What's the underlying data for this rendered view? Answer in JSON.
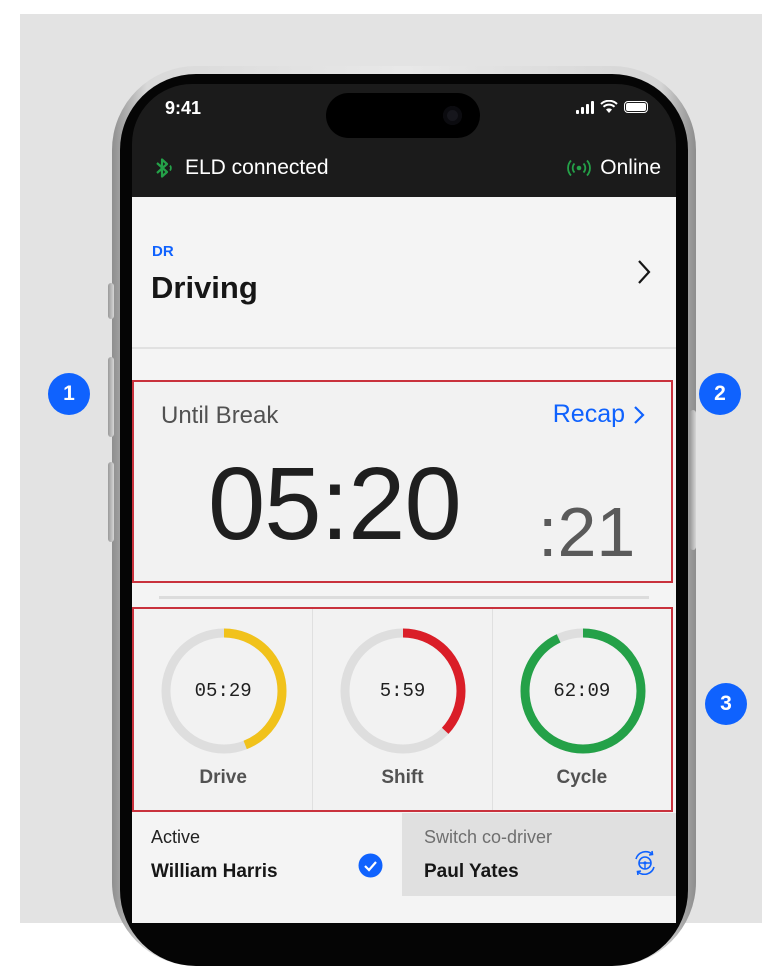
{
  "status_bar": {
    "time": "9:41"
  },
  "connection": {
    "eld_label": "ELD connected",
    "network_label": "Online"
  },
  "duty_status": {
    "code": "DR",
    "title": "Driving"
  },
  "break_timer": {
    "label": "Until Break",
    "recap_label": "Recap",
    "hours_minutes": "05:20",
    "seconds": ":21"
  },
  "gauges": [
    {
      "label": "Drive",
      "value": "05:29",
      "fraction": 0.44,
      "color": "#f1c21b"
    },
    {
      "label": "Shift",
      "value": "5:59",
      "fraction": 0.37,
      "color": "#da1e28"
    },
    {
      "label": "Cycle",
      "value": "62:09",
      "fraction": 0.93,
      "color": "#24a148"
    }
  ],
  "drivers": {
    "active_caption": "Active",
    "active_name": "William Harris",
    "switch_caption": "Switch co-driver",
    "switch_name": "Paul Yates"
  },
  "callouts": [
    "1",
    "2",
    "3"
  ],
  "colors": {
    "accent": "#0f62fe",
    "bluetooth": "#24a148",
    "highlight_border": "#c9323d"
  }
}
